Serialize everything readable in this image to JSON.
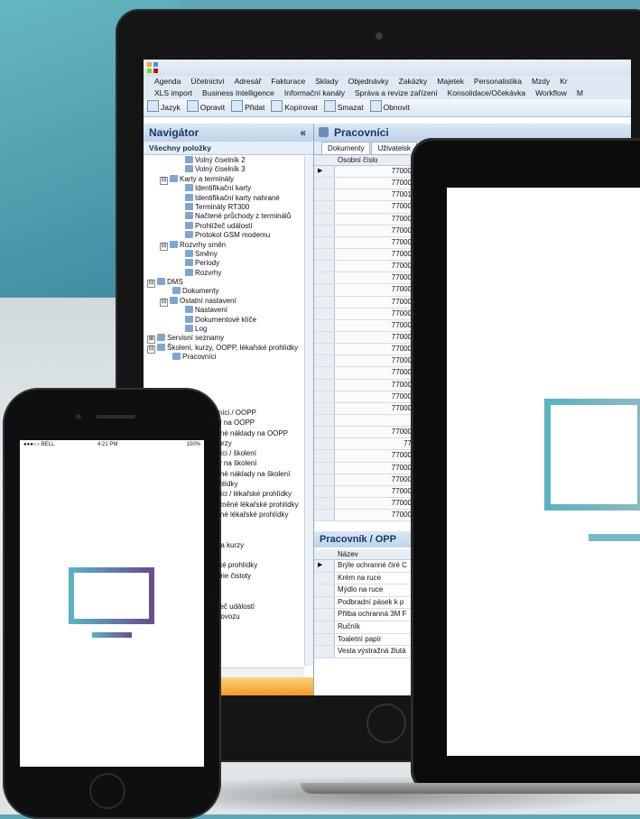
{
  "menu_row1": [
    "Agenda",
    "Účetnictví",
    "Adresář",
    "Fakturace",
    "Sklady",
    "Objednávky",
    "Zakázky",
    "Majetek",
    "Personalistika",
    "Mzdy",
    "Kr"
  ],
  "menu_row2": [
    "XLS import",
    "Business Intelligence",
    "Informační kanály",
    "Správa a revize zařízení",
    "Konsolidace/Očekávka",
    "Workflow",
    "M"
  ],
  "toolbar": [
    "Jazyk",
    "Opravit",
    "Přidat",
    "Kopírovat",
    "Smazat",
    "Obnovit"
  ],
  "navigator": {
    "title": "Navigátor",
    "collapse": "«",
    "subtitle": "Všechny položky",
    "tree": [
      {
        "text": "Volný číselník 2",
        "indent": 3
      },
      {
        "text": "Volný číselník 3",
        "indent": 3
      },
      {
        "text": "Karty a terminály",
        "indent": 1,
        "exp": "⊟"
      },
      {
        "text": "Identifikační karty",
        "indent": 3
      },
      {
        "text": "Identifikační karty nahrané",
        "indent": 3
      },
      {
        "text": "Terminály RT300",
        "indent": 3
      },
      {
        "text": "Načtené průchody z terminálů",
        "indent": 3
      },
      {
        "text": "Prohlížeč událostí",
        "indent": 3
      },
      {
        "text": "Protokol GSM modemu",
        "indent": 3
      },
      {
        "text": "Rozvrhy směn",
        "indent": 1,
        "exp": "⊟"
      },
      {
        "text": "Směny",
        "indent": 3
      },
      {
        "text": "Periody",
        "indent": 3
      },
      {
        "text": "Rozvrhy",
        "indent": 3
      },
      {
        "text": "DMS",
        "indent": 0,
        "exp": "⊟"
      },
      {
        "text": "Dokumenty",
        "indent": 2
      },
      {
        "text": "Ostatní nastavení",
        "indent": 1,
        "exp": "⊟"
      },
      {
        "text": "Nastavení",
        "indent": 3
      },
      {
        "text": "Dokumentové klíče",
        "indent": 3
      },
      {
        "text": "Log",
        "indent": 3
      },
      {
        "text": "Servisní seznamy",
        "indent": 0,
        "exp": "⊞"
      },
      {
        "text": "Školení, kurzy, OOPP, lékařské prohlídky",
        "indent": 0,
        "exp": "⊟"
      },
      {
        "text": "Pracovníci",
        "indent": 2
      }
    ],
    "phone_overlap_items": [
      "tovníci / OOPP",
      "lady na OOPP",
      "ované náklady na OOPP",
      "a kurzy",
      "ovníci / školení",
      "lady na školení",
      "ované náklady na školení",
      "prohlídky",
      "ovníci / lékařské prohlídky",
      "utečněné lékařské prohlídky",
      "ované lékařské prohlídky",
      "",
      "ese",
      "ení a kurzy",
      "P",
      "ařské prohlídky",
      "egorie čistoty",
      "ary",
      "lity",
      "hlížeč událostí",
      "y provozu"
    ]
  },
  "main": {
    "title": "Pracovníci",
    "tabs": [
      "Dokumenty",
      "Uživatelsk"
    ],
    "column": "Osobní číslo",
    "rows": [
      "77000",
      "77000",
      "77001",
      "77000",
      "77000",
      "77000",
      "77000",
      "77000",
      "77000",
      "77000",
      "77000",
      "77000",
      "77000",
      "77000",
      "77000",
      "77000",
      "77000",
      "77000",
      "77000",
      "77000",
      "77000",
      "",
      "77000",
      "77",
      "77000",
      "77000",
      "77000",
      "77000",
      "77000",
      "77000"
    ],
    "panel2_title": "Pracovník / OPP",
    "panel2_column": "Název",
    "panel2_rows": [
      "Brýle ochranné čiré C",
      "Krém na ruce",
      "Mýdlo na ruce",
      "Podbradní pásek k p",
      "Přilba ochranná 3M F",
      "Ručník",
      "Toaletní papír",
      "Vesta výstražná žlutá"
    ]
  },
  "phone": {
    "carrier": "●●●○○ BELL",
    "time": "4:21 PM",
    "battery": "100%"
  },
  "colors": {
    "accent": "#5cb2c0",
    "accent2": "#6a4d8e",
    "nav_header": "#bfd3e8",
    "orange": "#f39a26"
  }
}
